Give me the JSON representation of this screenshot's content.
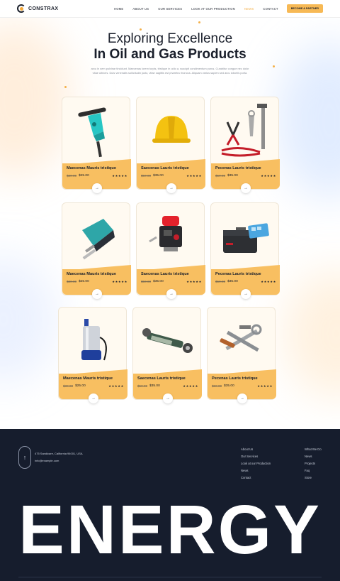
{
  "brand": {
    "name": "CONSTRAX",
    "accent": "#f7b955",
    "dark": "#161d2d"
  },
  "nav": {
    "items": [
      "HOME",
      "ABOUT US",
      "OUR SERVICES",
      "LOOK AT OUR PRODUCTION",
      "NEWS",
      "CONTACT"
    ],
    "active_index": 4,
    "cta": "BECOME A PARTNER"
  },
  "hero": {
    "title_line1": "Exploring Excellence",
    "title_line2": "In Oil and Gas Products",
    "description": "arcu in sem pulvinar tincidunt. Maecenas lorem turpis, tristique in odio a, suscipit condimentum purus. Curabitur congue nec dolor vitae ultrices. Duis venenatis sollicitudin justo, vitae sagittis est pharetra rhoncus. Aliquam varius sapien sed arcu lobortis porta."
  },
  "products": [
    {
      "name": "Maecenas Mauris tristique",
      "old_price": "$30.00",
      "price": "$25.00",
      "rating": 5,
      "icon": "jackhammer-icon"
    },
    {
      "name": "Saecenas Lauris tristique",
      "old_price": "$50.00",
      "price": "$35.00",
      "rating": 5,
      "icon": "hard-hat-icon"
    },
    {
      "name": "Pecenas Lauris tristique",
      "old_price": "$50.00",
      "price": "$35.00",
      "rating": 5,
      "icon": "hand-tools-icon"
    },
    {
      "name": "Maecenas Mauris tristique",
      "old_price": "$30.00",
      "price": "$25.00",
      "rating": 5,
      "icon": "jigsaw-icon"
    },
    {
      "name": "Saecenas Lauris tristique",
      "old_price": "$50.00",
      "price": "$35.00",
      "rating": 5,
      "icon": "pump-controller-icon"
    },
    {
      "name": "Pecenas Lauris tristique",
      "old_price": "$50.00",
      "price": "$35.00",
      "rating": 5,
      "icon": "toolbox-icon"
    },
    {
      "name": "Maecenas Mauris tristique",
      "old_price": "$30.00",
      "price": "$25.00",
      "rating": 5,
      "icon": "submersible-pump-icon"
    },
    {
      "name": "Saecenas Lauris tristique",
      "old_price": "$50.00",
      "price": "$35.00",
      "rating": 5,
      "icon": "hydraulic-cylinder-icon"
    },
    {
      "name": "Pecenas Lauris tristique",
      "old_price": "$50.00",
      "price": "$35.00",
      "rating": 5,
      "icon": "wrench-set-icon"
    }
  ],
  "footer": {
    "address": "475 Sandicare, California 94001, USA",
    "email": "info@example.com",
    "col1": [
      "About Us",
      "Our Services",
      "Look at our Production",
      "News",
      "Contact"
    ],
    "col2": [
      "What We Do",
      "News",
      "Projects",
      "Faq",
      "Store"
    ],
    "big_word": "ENERGY"
  }
}
